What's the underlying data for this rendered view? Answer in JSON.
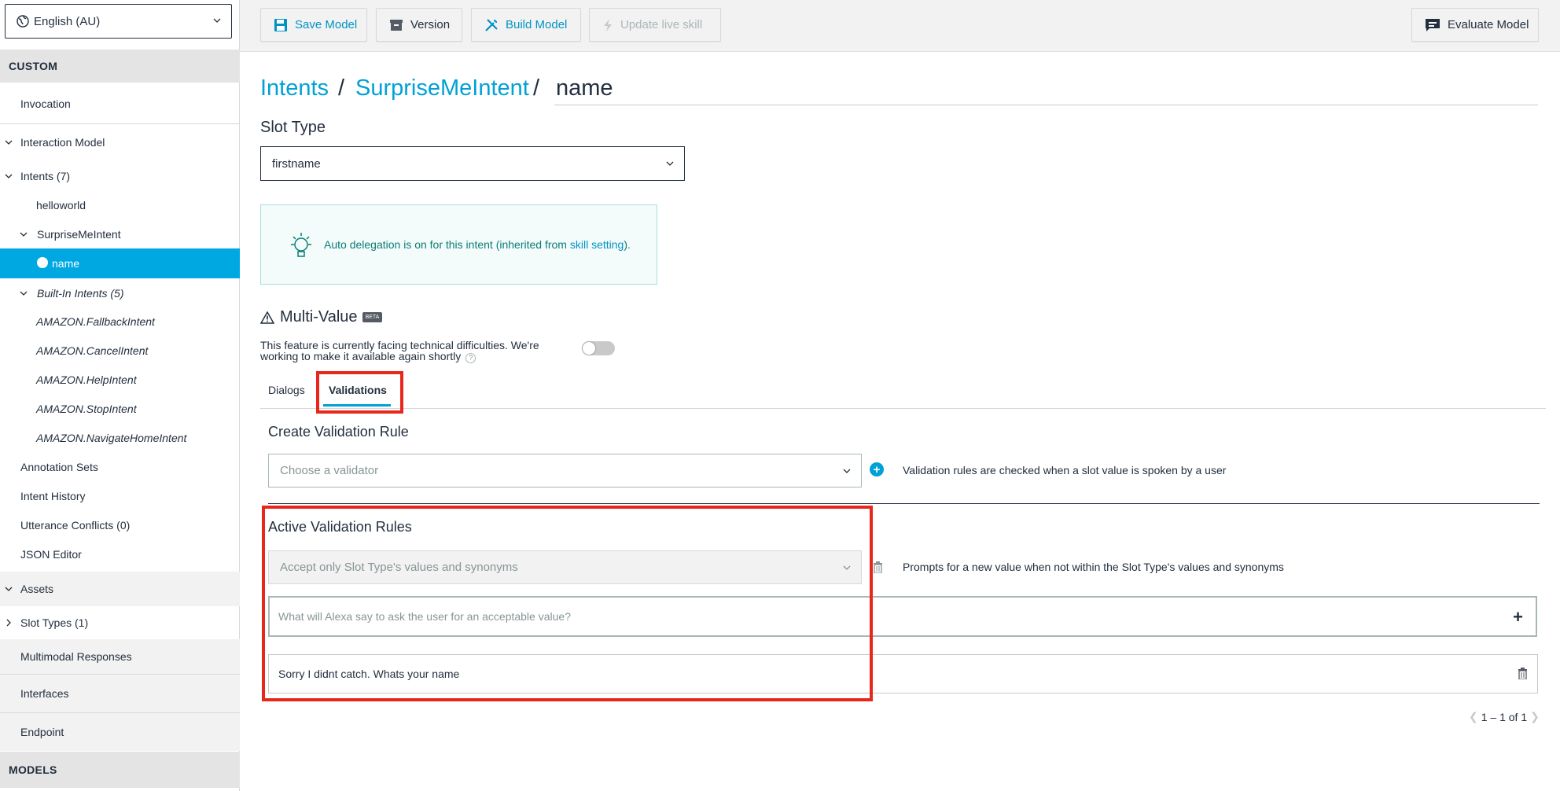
{
  "locale": {
    "value": "English (AU)"
  },
  "sidebar": {
    "custom_header": "CUSTOM",
    "models_header": "MODELS",
    "items": [
      {
        "label": "Invocation"
      },
      {
        "label": "Interaction Model"
      },
      {
        "label": "Intents (7)"
      },
      {
        "label": "helloworld"
      },
      {
        "label": "SurpriseMeIntent"
      },
      {
        "label": "name"
      },
      {
        "label": "Built-In Intents (5)"
      },
      {
        "label": "AMAZON.FallbackIntent"
      },
      {
        "label": "AMAZON.CancelIntent"
      },
      {
        "label": "AMAZON.HelpIntent"
      },
      {
        "label": "AMAZON.StopIntent"
      },
      {
        "label": "AMAZON.NavigateHomeIntent"
      },
      {
        "label": "Annotation Sets"
      },
      {
        "label": "Intent History"
      },
      {
        "label": "Utterance Conflicts (0)"
      },
      {
        "label": "JSON Editor"
      },
      {
        "label": "Assets"
      },
      {
        "label": "Slot Types (1)"
      },
      {
        "label": "Multimodal Responses"
      },
      {
        "label": "Interfaces"
      },
      {
        "label": "Endpoint"
      }
    ]
  },
  "toolbar": {
    "save_label": "Save Model",
    "version_label": "Version",
    "build_label": "Build Model",
    "update_label": "Update live skill",
    "evaluate_label": "Evaluate Model"
  },
  "breadcrumb": {
    "intents": "Intents",
    "sep": "/",
    "intent": "SurpriseMeIntent",
    "slot": "name"
  },
  "slot_type": {
    "title": "Slot Type",
    "value": "firstname"
  },
  "tip": {
    "text_prefix": "Auto delegation is on for this intent (inherited from ",
    "link": "skill setting",
    "text_suffix": ")."
  },
  "multi_value": {
    "title": "Multi-Value",
    "badge": "BETA",
    "note_line1": "This feature is currently facing technical difficulties. We're",
    "note_line2": "working to make it available again shortly",
    "help": "?"
  },
  "tabs": [
    {
      "label": "Dialogs"
    },
    {
      "label": "Validations"
    }
  ],
  "create_rule": {
    "title": "Create Validation Rule",
    "placeholder": "Choose a validator",
    "hint": "Validation rules are checked when a slot value is spoken by a user"
  },
  "active_rules": {
    "title": "Active Validation Rules",
    "rule": "Accept only Slot Type's values and synonyms",
    "rule_desc": "Prompts for a new value when not within the Slot Type's values and synonyms",
    "prompt_placeholder": "What will Alexa say to ask the user for an acceptable value?",
    "prompts": [
      "Sorry I didnt catch. Whats your name"
    ]
  },
  "pagination": {
    "text": "1 – 1 of 1"
  },
  "colors": {
    "accent": "#00a1d6",
    "highlight": "#e8271c",
    "active_nav": "#00a8e1"
  }
}
